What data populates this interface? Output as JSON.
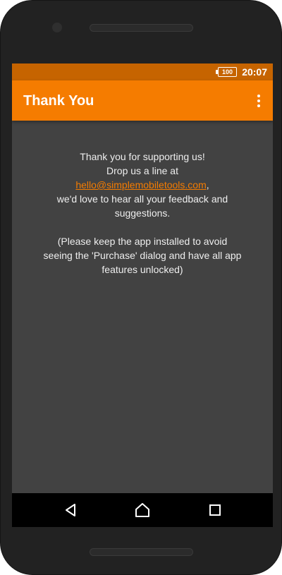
{
  "status_bar": {
    "battery_level": "100",
    "time": "20:07"
  },
  "app_bar": {
    "title": "Thank You",
    "overflow_icon": "more-vert-icon"
  },
  "content": {
    "line1": "Thank you for supporting us!",
    "line2": "Drop us a line at",
    "email": "hello@simplemobiletools.com",
    "email_suffix": ",",
    "line3": "we'd love to hear all your feedback and",
    "line4": "suggestions.",
    "note_line1": "(Please keep the app installed to avoid",
    "note_line2": "seeing the 'Purchase' dialog and have all app",
    "note_line3": "features unlocked)"
  },
  "nav_bar": {
    "back_icon": "back-triangle-icon",
    "home_icon": "home-pentagon-icon",
    "recent_icon": "recent-apps-square-icon"
  },
  "colors": {
    "primary": "#f57c00",
    "primary_dark": "#c66400",
    "background": "#424242",
    "text": "#eeeeee"
  }
}
